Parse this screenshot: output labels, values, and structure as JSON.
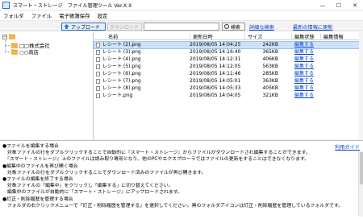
{
  "window": {
    "title": "スマート・ストレージ　ファイル管理ツール Ver.X.X",
    "controls": [
      "—",
      "☐",
      "✕"
    ]
  },
  "menu": [
    "フォルダ",
    "ファイル",
    "電子帳簿保存",
    "設定"
  ],
  "toolbar": {
    "upload_label": "アップロード",
    "disabled_label": "ダウンロード",
    "search_placeholder": "",
    "search_label": "検索",
    "advanced_search": "詳細な検索",
    "refresh_latest": "最新の情報に更新"
  },
  "tree": {
    "root_expander": "−",
    "items": [
      {
        "label": "□□株式会社"
      },
      {
        "label": "○○商店"
      }
    ]
  },
  "file_list": {
    "columns": [
      "名前",
      "更新日時",
      "サイズ",
      "編集状態",
      "編集情報"
    ],
    "rows": [
      {
        "name": "レシート (2).png",
        "date": "2019/08/05 14:04:25",
        "size": "242KB",
        "status": "編集する",
        "info": "",
        "selected": true
      },
      {
        "name": "レシート (3).png",
        "date": "2019/08/05 14:16:40",
        "size": "365KB",
        "status": "編集する",
        "info": "",
        "selected": false
      },
      {
        "name": "レシート (4).png",
        "date": "2019/08/05 14:12:31",
        "size": "406KB",
        "status": "編集する",
        "info": "",
        "selected": false
      },
      {
        "name": "レシート (5).png",
        "date": "2019/08/05 14:12:05",
        "size": "563KB",
        "status": "編集する",
        "info": "",
        "selected": false
      },
      {
        "name": "レシート (6).png",
        "date": "2019/08/05 14:11:46",
        "size": "285KB",
        "status": "編集する",
        "info": "",
        "selected": false
      },
      {
        "name": "レシート (7).png",
        "date": "2019/08/05 14:05:01",
        "size": "363KB",
        "status": "編集する",
        "info": "",
        "selected": false
      },
      {
        "name": "レシート (8).png",
        "date": "2019/08/05 14:05:33",
        "size": "405KB",
        "status": "編集する",
        "info": "",
        "selected": false
      },
      {
        "name": "レシート.png",
        "date": "2019/08/05 14:04:05",
        "size": "321KB",
        "status": "編集する",
        "info": "",
        "selected": false
      }
    ]
  },
  "help": {
    "guide_link": "利用ガイド",
    "lines": [
      "●ファイルを編集する場合",
      "　対象ファイルの行をダブルクリックすることで自動的に『スマート・ストレージ』からファイルがダウンロードされ編集することができます。",
      "　『スマート・ストレージ』上のファイルは読み取り専用となり、他のPCやエクスプローラではファイルの更新をすることはできなくなります。",
      "●編集中のファイルを再び開く場合",
      "　対象ファイルの行をダブルクリックすることでダウンロード済みのファイルが再び開きます。",
      "●ファイルの編集を終了する場合",
      "　対象ファイルの「編集中」をクリックし「編集する」に切り替えてください。",
      "　編集中のファイルが自動的に『スマート・ストレージ』にアップロードされます。",
      "●訂正・削除履歴を管理する場合",
      "　フォルダの右クリックメニューで「訂正・削除履歴を管理する」を選択してください。黒のフォルダアイコンは訂正・削除履歴を管理しているフォルダです。"
    ]
  }
}
